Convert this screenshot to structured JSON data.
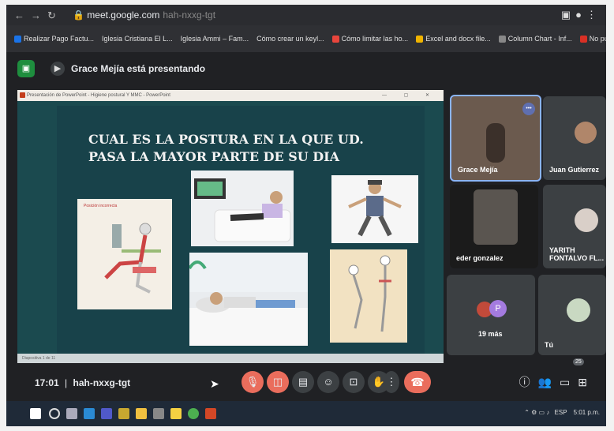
{
  "browser": {
    "url": "meet.google.com",
    "url_suffix": "hah-nxxg-tgt"
  },
  "bookmarks": [
    {
      "label": "Realizar Pago Factu...",
      "color": "#1a73e8"
    },
    {
      "label": "Iglesia Cristiana El L...",
      "color": "#777777"
    },
    {
      "label": "Iglesia Ammi – Fam...",
      "color": "#777777"
    },
    {
      "label": "Cómo crear un keyl...",
      "color": "#777777"
    },
    {
      "label": "Cómo limitar las ho...",
      "color": "#e8453c"
    },
    {
      "label": "Excel and docx file...",
      "color": "#f0b400"
    },
    {
      "label": "Column Chart - Inf...",
      "color": "#888888"
    },
    {
      "label": "No puedo abrir arc...",
      "color": "#d93025"
    }
  ],
  "meet": {
    "logo": "▣",
    "presenting_text": "Grace Mejía está presentando"
  },
  "ppt": {
    "window_title": "Presentación de PowerPoint - Higiene postural Y MMC - PowerPoint",
    "window_controls": "— ▢ ✕",
    "status_text": "Diapositiva 1 de 11",
    "slide_title": "CUAL ES  LA POSTURA EN LA QUE UD. PASA LA MAYOR PARTE DE SU DIA",
    "inset_label": "Posición incorrecta"
  },
  "participants": [
    {
      "name": "Grace Mejía",
      "more": "•••"
    },
    {
      "name": "Juan Gutierrez"
    },
    {
      "name": "eder gonzalez"
    },
    {
      "name": "YARITH FONTALVO FL..."
    },
    {
      "name": "19 más",
      "initial": "P"
    },
    {
      "name": "Tú"
    }
  ],
  "toolbar": {
    "time": "17:01",
    "separator": "|",
    "meeting_code": "hah-nxxg-tgt",
    "people_count": "25"
  },
  "taskbar": {
    "lang": "ESP",
    "time": "5:01 p.m."
  },
  "colors": {
    "end_call": "#ea6d5c",
    "meet_green": "#1e8e3e",
    "slide_bg": "#18424a"
  }
}
